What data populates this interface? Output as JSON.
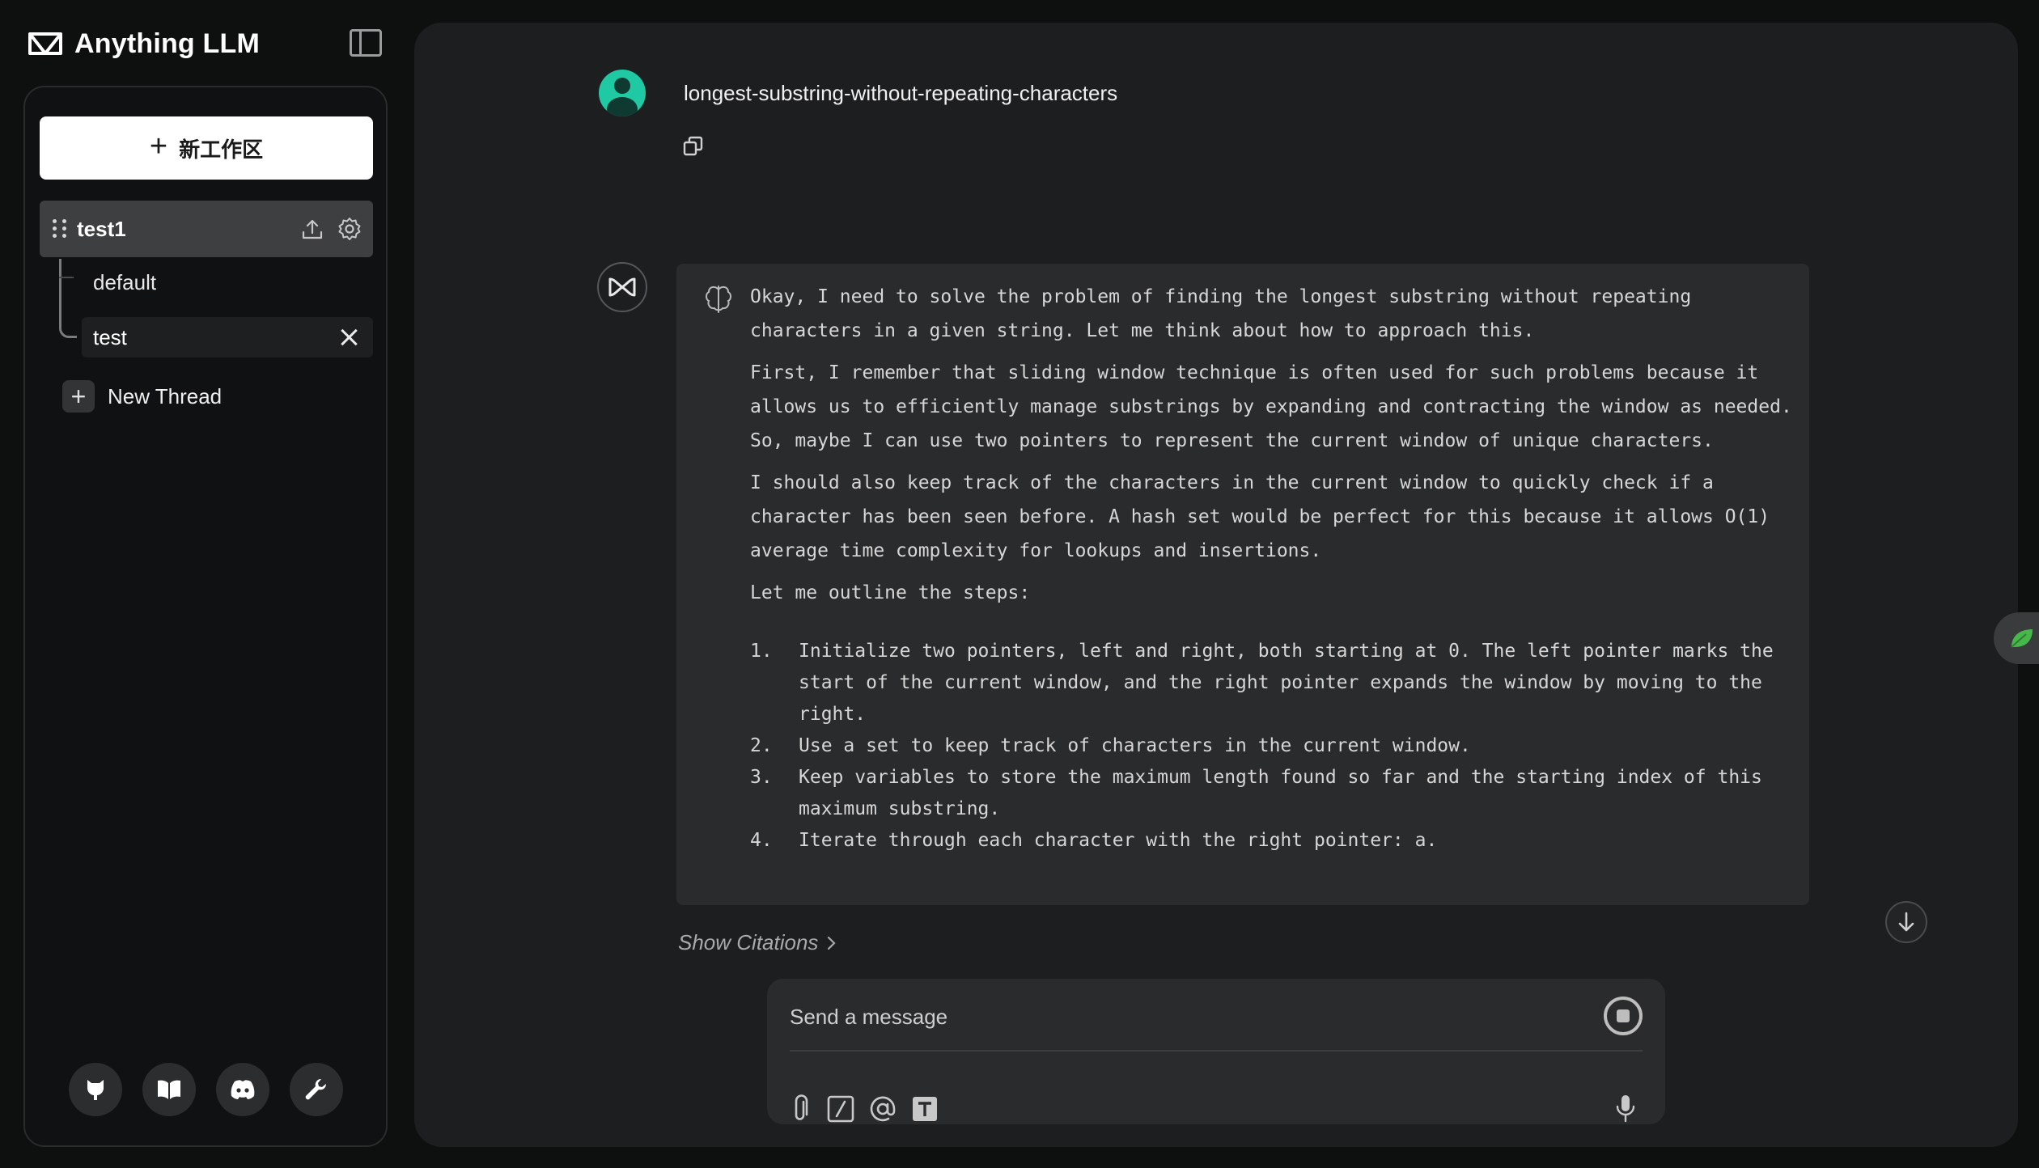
{
  "app": {
    "brand_name": "Anything LLM",
    "brand_icon": "anythingllm-logo-icon"
  },
  "sidebar": {
    "new_workspace_label": "新工作区",
    "workspace": {
      "name": "test1",
      "upload_icon": "upload-icon",
      "settings_icon": "gear-icon"
    },
    "threads": [
      {
        "label": "default",
        "active": false
      },
      {
        "label": "test",
        "active": true
      }
    ],
    "new_thread_label": "New Thread",
    "footer_icons": [
      "github-icon",
      "book-icon",
      "discord-icon",
      "wrench-icon"
    ]
  },
  "chat": {
    "user_message": "longest-substring-without-repeating-characters",
    "thought_paragraphs": [
      "Okay, I need to solve the problem of finding the longest substring without repeating characters in a given string. Let me think about how to approach this.",
      "First, I remember that sliding window technique is often used for such problems because it allows us to efficiently manage substrings by expanding and contracting the window as needed. So, maybe I can use two pointers to represent the current window of unique characters.",
      "I should also keep track of the characters in the current window to quickly check if a character has been seen before. A hash set would be perfect for this because it allows O(1) average time complexity for lookups and insertions.",
      "Let me outline the steps:"
    ],
    "thought_steps": [
      {
        "num": "1.",
        "text": "Initialize two pointers, left and right, both starting at 0. The left pointer marks the start of the current window, and the right pointer expands the window by moving to the right."
      },
      {
        "num": "2.",
        "text": "Use a set to keep track of characters in the current window."
      },
      {
        "num": "3.",
        "text": "Keep variables to store the maximum length found so far and the starting index of this maximum substring."
      },
      {
        "num": "4.",
        "text": "Iterate through each character with the right pointer: a."
      }
    ],
    "show_citations_label": "Show Citations"
  },
  "composer": {
    "placeholder": "Send a message",
    "tools": [
      "paperclip-icon",
      "slash-command-icon",
      "at-mention-icon",
      "text-format-icon"
    ],
    "mic_icon": "microphone-icon",
    "stop_icon": "stop-icon"
  },
  "colors": {
    "background": "#0e0f0f",
    "main_panel": "#1d1e20",
    "thought_box": "#2a2b2d",
    "avatar": "#1ec9a3",
    "active_workspace": "#3e3f41"
  }
}
